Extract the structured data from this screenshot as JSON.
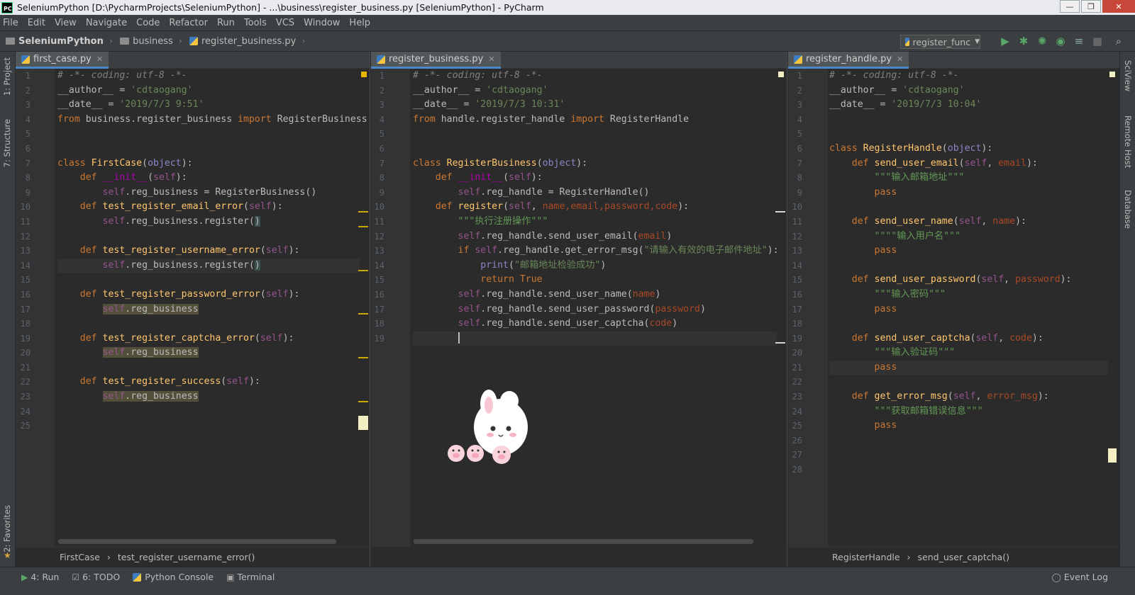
{
  "window": {
    "title": "SeleniumPython [D:\\PycharmProjects\\SeleniumPython] - ...\\business\\register_business.py [SeleniumPython] - PyCharm",
    "app_badge": "PC",
    "minimize": "—",
    "maximize": "❐",
    "close": "✕"
  },
  "menu": [
    "File",
    "Edit",
    "View",
    "Navigate",
    "Code",
    "Refactor",
    "Run",
    "Tools",
    "VCS",
    "Window",
    "Help"
  ],
  "navbar": {
    "project": "SeleniumPython",
    "folder": "business",
    "file": "register_business.py",
    "run_config": "register_func"
  },
  "left_tool_tabs": {
    "project": "1: Project",
    "structure": "7: Structure",
    "favorites": "2: Favorites"
  },
  "right_tool_tabs": {
    "sciview": "SciView",
    "remote_host": "Remote Host",
    "database": "Database"
  },
  "editors": [
    {
      "tab": "first_case.py",
      "breadcrumb": [
        "FirstCase",
        "test_register_username_error()"
      ],
      "lines": [
        "1",
        "2",
        "3",
        "4",
        "5",
        "6",
        "7",
        "8",
        "9",
        "10",
        "11",
        "12",
        "13",
        "14",
        "15",
        "16",
        "17",
        "18",
        "19",
        "20",
        "21",
        "22",
        "23",
        "24",
        "25"
      ]
    },
    {
      "tab": "register_business.py",
      "breadcrumb": [],
      "lines": [
        "1",
        "2",
        "3",
        "4",
        "5",
        "6",
        "7",
        "8",
        "9",
        "10",
        "11",
        "12",
        "13",
        "14",
        "15",
        "16",
        "17",
        "18",
        "19"
      ]
    },
    {
      "tab": "register_handle.py",
      "breadcrumb": [
        "RegisterHandle",
        "send_user_captcha()"
      ],
      "lines": [
        "1",
        "2",
        "3",
        "4",
        "5",
        "6",
        "7",
        "8",
        "9",
        "10",
        "11",
        "12",
        "13",
        "14",
        "15",
        "16",
        "17",
        "18",
        "19",
        "20",
        "21",
        "22",
        "23",
        "24",
        "25",
        "26",
        "27",
        "28"
      ]
    }
  ],
  "code": {
    "comment": "# -*- coding: utf-8 -*-",
    "author_kw": "__author__ = ",
    "author": "'cdtaogang'",
    "date_kw": "__date__ = ",
    "date_a": "'2019/7/3 9:51'",
    "date_b": "'2019/7/3 10:31'",
    "date_c": "'2019/7/3 10:04'",
    "a_import": " business.register_business ",
    "a_import_name": " RegisterBusiness",
    "a_class": "FirstCase",
    "a_init_body": "reg_business = RegisterBusiness()",
    "a_m1": "test_register_email_error",
    "a_m2": "test_register_username_error",
    "a_m3": "test_register_password_error",
    "a_m4": "test_register_captcha_error",
    "a_m5": "test_register_success",
    "a_call": ".reg_business.register(",
    "a_attr": ".reg_business",
    "b_import": " handle.register_handle ",
    "b_import_name": " RegisterHandle",
    "b_class": "RegisterBusiness",
    "b_init_body": ".reg_handle = RegisterHandle()",
    "b_register": "register",
    "b_register_params": "name,email,password,code",
    "b_doc": "\"\"\"执行注册操作\"\"\"",
    "b_send_email": ".reg_handle.send_user_email(",
    "b_if_call": ".reg_handle.get_error_msg(",
    "b_if_str": "\"请输入有效的电子邮件地址\"",
    "b_print_str": "\"邮箱地址检验成功\"",
    "b_return": "True",
    "b_send_name": ".reg_handle.send_user_name(",
    "b_send_password": ".reg_handle.send_user_password(",
    "b_send_captcha": ".reg_handle.send_user_captcha(",
    "c_class": "RegisterHandle",
    "c_m1": "send_user_email",
    "c_m1_arg": "email",
    "c_m1_doc": "\"\"\"输入邮箱地址\"\"\"",
    "c_m2": "send_user_name",
    "c_m2_arg": "name",
    "c_m2_doc": "\"\"\"\"输入用户名\"\"\"",
    "c_m3": "send_user_password",
    "c_m3_arg": "password",
    "c_m3_doc": "\"\"\"输入密码\"\"\"",
    "c_m4": "send_user_captcha",
    "c_m4_arg": "code",
    "c_m4_doc": "\"\"\"输入验证码\"\"\"",
    "c_m5": "get_error_msg",
    "c_m5_arg": "error_msg",
    "c_m5_doc": "\"\"\"获取邮箱错误信息\"\"\""
  },
  "statusbar": {
    "run": "4: Run",
    "todo": "6: TODO",
    "console": "Python Console",
    "terminal": "Terminal",
    "event_log": "Event Log"
  },
  "colors": {
    "keyword": "#cc7832",
    "function": "#ffc66d",
    "string": "#6a8759",
    "self": "#94558d",
    "editor_bg": "#2b2b2b",
    "panel_bg": "#3c3f41"
  }
}
